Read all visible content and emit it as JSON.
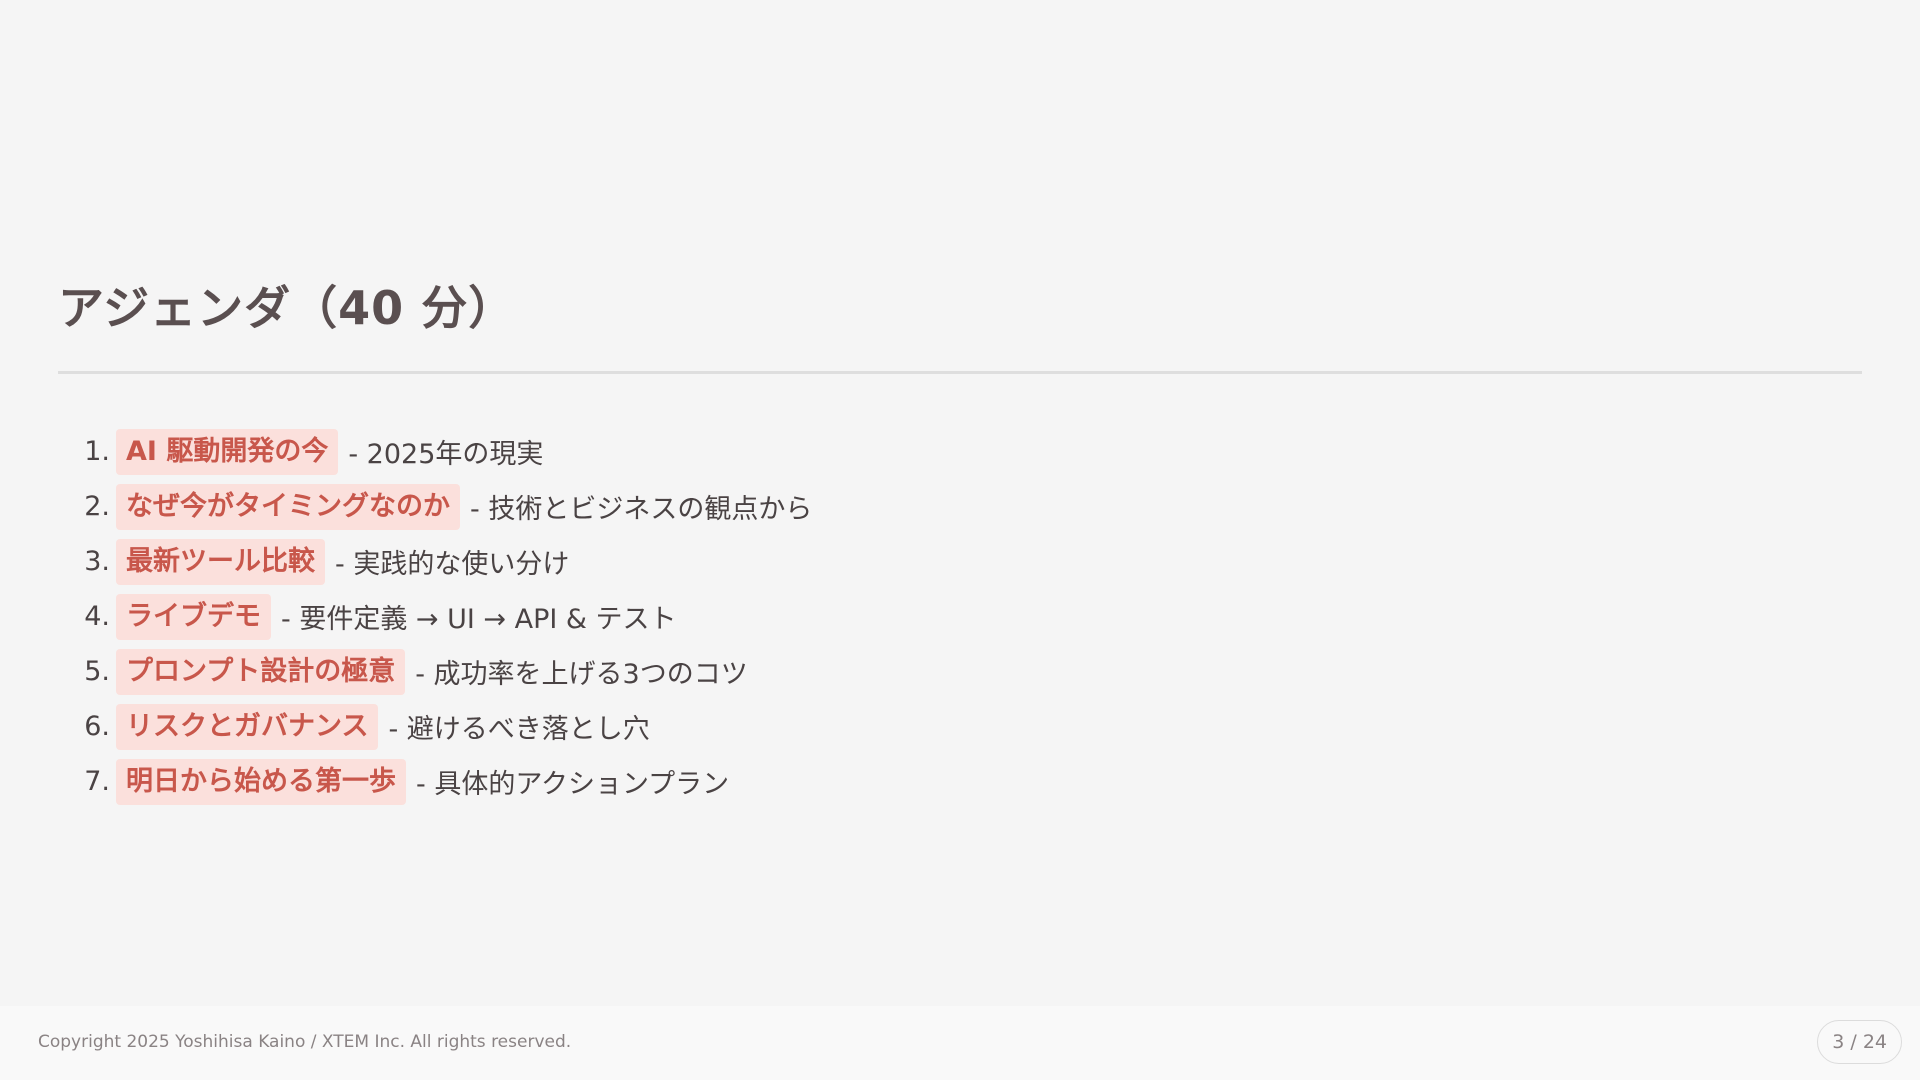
{
  "slide": {
    "title": "アジェンダ（40 分）",
    "agenda": [
      {
        "number": "1.",
        "topic": "AI 駆動開発の今",
        "description": "- 2025年の現実"
      },
      {
        "number": "2.",
        "topic": "なぜ今がタイミングなのか",
        "description": "- 技術とビジネスの観点から"
      },
      {
        "number": "3.",
        "topic": "最新ツール比較",
        "description": "- 実践的な使い分け"
      },
      {
        "number": "4.",
        "topic": "ライブデモ",
        "description": "- 要件定義 → UI → API & テスト"
      },
      {
        "number": "5.",
        "topic": "プロンプト設計の極意",
        "description": "- 成功率を上げる3つのコツ"
      },
      {
        "number": "6.",
        "topic": "リスクとガバナンス",
        "description": "- 避けるべき落とし穴"
      },
      {
        "number": "7.",
        "topic": "明日から始める第一歩",
        "description": "- 具体的アクションプラン"
      }
    ]
  },
  "footer": {
    "copyright": "Copyright 2025 Yoshihisa Kaino / XTEM Inc. All rights reserved.",
    "page_indicator": "3 / 24"
  },
  "colors": {
    "background": "#f5f5f5",
    "highlight_bg": "#fbe0dc",
    "highlight_text": "#c8574b",
    "title_text": "#5a4f50"
  }
}
